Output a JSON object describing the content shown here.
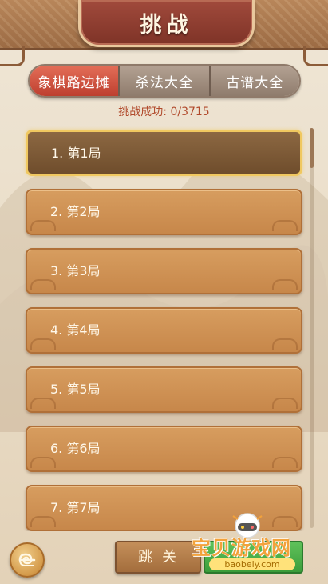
{
  "header": {
    "title": "挑战"
  },
  "tabs": [
    {
      "label": "象棋路边摊",
      "active": true
    },
    {
      "label": "杀法大全",
      "active": false
    },
    {
      "label": "古谱大全",
      "active": false
    }
  ],
  "status": {
    "text": "挑战成功: 0/3715"
  },
  "levels": [
    {
      "label": "1. 第1局",
      "selected": true
    },
    {
      "label": "2. 第2局"
    },
    {
      "label": "3. 第3局"
    },
    {
      "label": "4. 第4局"
    },
    {
      "label": "5. 第5局"
    },
    {
      "label": "6. 第6局"
    },
    {
      "label": "7. 第7局"
    }
  ],
  "footer": {
    "jump_label": "跳关",
    "back_icon": "swirl-back-icon"
  },
  "watermark": {
    "text": "宝贝游戏网",
    "url": "baobeiy.com"
  },
  "colors": {
    "accent": "#c7874a",
    "active_tab": "#d0523f",
    "status_text": "#b14a2c"
  }
}
